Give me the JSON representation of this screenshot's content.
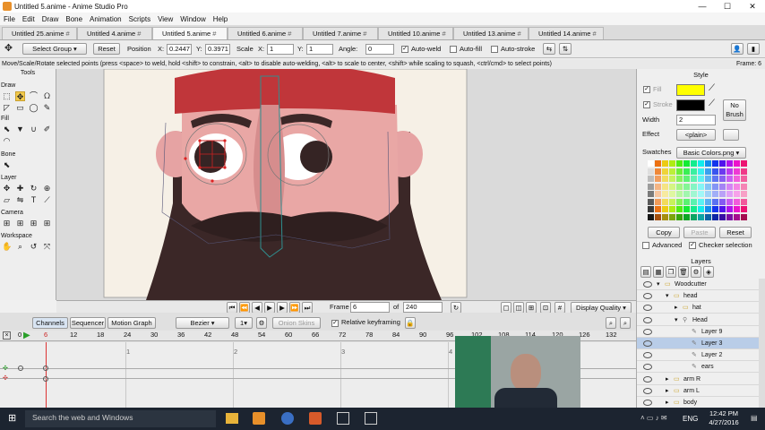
{
  "window": {
    "title": "Untitled 5.anime - Anime Studio Pro",
    "minimize": "—",
    "maximize": "☐",
    "close": "✕"
  },
  "menu": [
    "File",
    "Edit",
    "Draw",
    "Bone",
    "Animation",
    "Scripts",
    "View",
    "Window",
    "Help"
  ],
  "tabs": [
    "Untitled 25.anime",
    "Untitled 4.anime",
    "Untitled 5.anime",
    "Untitled 6.anime",
    "Untitled 7.anime",
    "Untitled 10.anime",
    "Untitled 13.anime",
    "Untitled 14.anime"
  ],
  "tab_close": "#",
  "tool_options": {
    "select_group": "Select Group",
    "reset": "Reset",
    "position_label": "Position",
    "x_label": "X:",
    "x_value": "0.2447",
    "y_label": "Y:",
    "y_value": "0.3971",
    "scale_label": "Scale",
    "scale_x_label": "X:",
    "scale_x_value": "1",
    "scale_y_label": "Y:",
    "scale_y_value": "1",
    "angle_label": "Angle:",
    "angle_value": "0",
    "auto_weld": "Auto-weld",
    "auto_fill": "Auto-fill",
    "auto_stroke": "Auto-stroke"
  },
  "status": {
    "hint": "Move/Scale/Rotate selected points (press <space> to weld, hold <shift> to constrain, <alt> to disable auto-welding, <alt> to scale to center, <shift> while scaling to squash, <ctrl/cmd> to select points)",
    "frame": "Frame: 6"
  },
  "tools": {
    "title": "Tools",
    "draw": "Draw",
    "fill": "Fill",
    "bone": "Bone",
    "layer": "Layer",
    "camera": "Camera",
    "workspace": "Workspace"
  },
  "frame_controls": {
    "frame_label": "Frame",
    "frame_value": "6",
    "of_label": "of",
    "total_value": "240",
    "display_quality": "Display Quality"
  },
  "timeline": {
    "tab_channels": "Channels",
    "tab_sequencer": "Sequencer",
    "tab_motion_graph": "Motion Graph",
    "interp": "Bezier",
    "interp_count": "1",
    "onion": "Onion Skins",
    "relative_keyframing": "Relative keyframing",
    "ticks": [
      "0",
      "6",
      "12",
      "18",
      "24",
      "30",
      "36",
      "42",
      "48",
      "54",
      "60",
      "66",
      "72",
      "78",
      "84",
      "90",
      "96",
      "102",
      "108",
      "114",
      "120",
      "126",
      "132"
    ],
    "markers": [
      "1",
      "2",
      "3",
      "4"
    ]
  },
  "style": {
    "title": "Style",
    "fill_label": "Fill",
    "stroke_label": "Stroke",
    "fill_color": "#ffff00",
    "stroke_color": "#000000",
    "no_brush": "No Brush",
    "width_label": "Width",
    "width_value": "2",
    "effect_label": "Effect",
    "effect_value": "<plain>",
    "swatches_label": "Swatches",
    "swatches_value": "Basic Colors.png",
    "copy": "Copy",
    "paste": "Paste",
    "reset": "Reset",
    "advanced": "Advanced",
    "checker": "Checker selection"
  },
  "layers": {
    "title": "Layers",
    "items": [
      {
        "name": "Woodcutter",
        "depth": 0,
        "type": "folder",
        "expanded": true
      },
      {
        "name": "head",
        "depth": 1,
        "type": "folder",
        "expanded": true
      },
      {
        "name": "hat",
        "depth": 2,
        "type": "folder",
        "expanded": false
      },
      {
        "name": "Head",
        "depth": 2,
        "type": "bone",
        "expanded": true
      },
      {
        "name": "Layer 9",
        "depth": 3,
        "type": "vector"
      },
      {
        "name": "Layer 3",
        "depth": 3,
        "type": "vector",
        "selected": true
      },
      {
        "name": "Layer 2",
        "depth": 3,
        "type": "vector"
      },
      {
        "name": "ears",
        "depth": 3,
        "type": "vector"
      },
      {
        "name": "arm R",
        "depth": 1,
        "type": "folder",
        "expanded": false
      },
      {
        "name": "arm L",
        "depth": 1,
        "type": "folder",
        "expanded": false
      },
      {
        "name": "body",
        "depth": 1,
        "type": "folder",
        "expanded": false
      }
    ]
  },
  "taskbar": {
    "search": "Search the web and Windows",
    "lang": "ENG",
    "time": "12:42 PM",
    "date": "4/27/2016"
  },
  "colors": {
    "accent": "#3399ff",
    "selection": "#b9cde8",
    "skin": "#e8a6a4",
    "beard": "#3a2828",
    "hat": "#c0363a",
    "taskbar": "#1c2430"
  }
}
